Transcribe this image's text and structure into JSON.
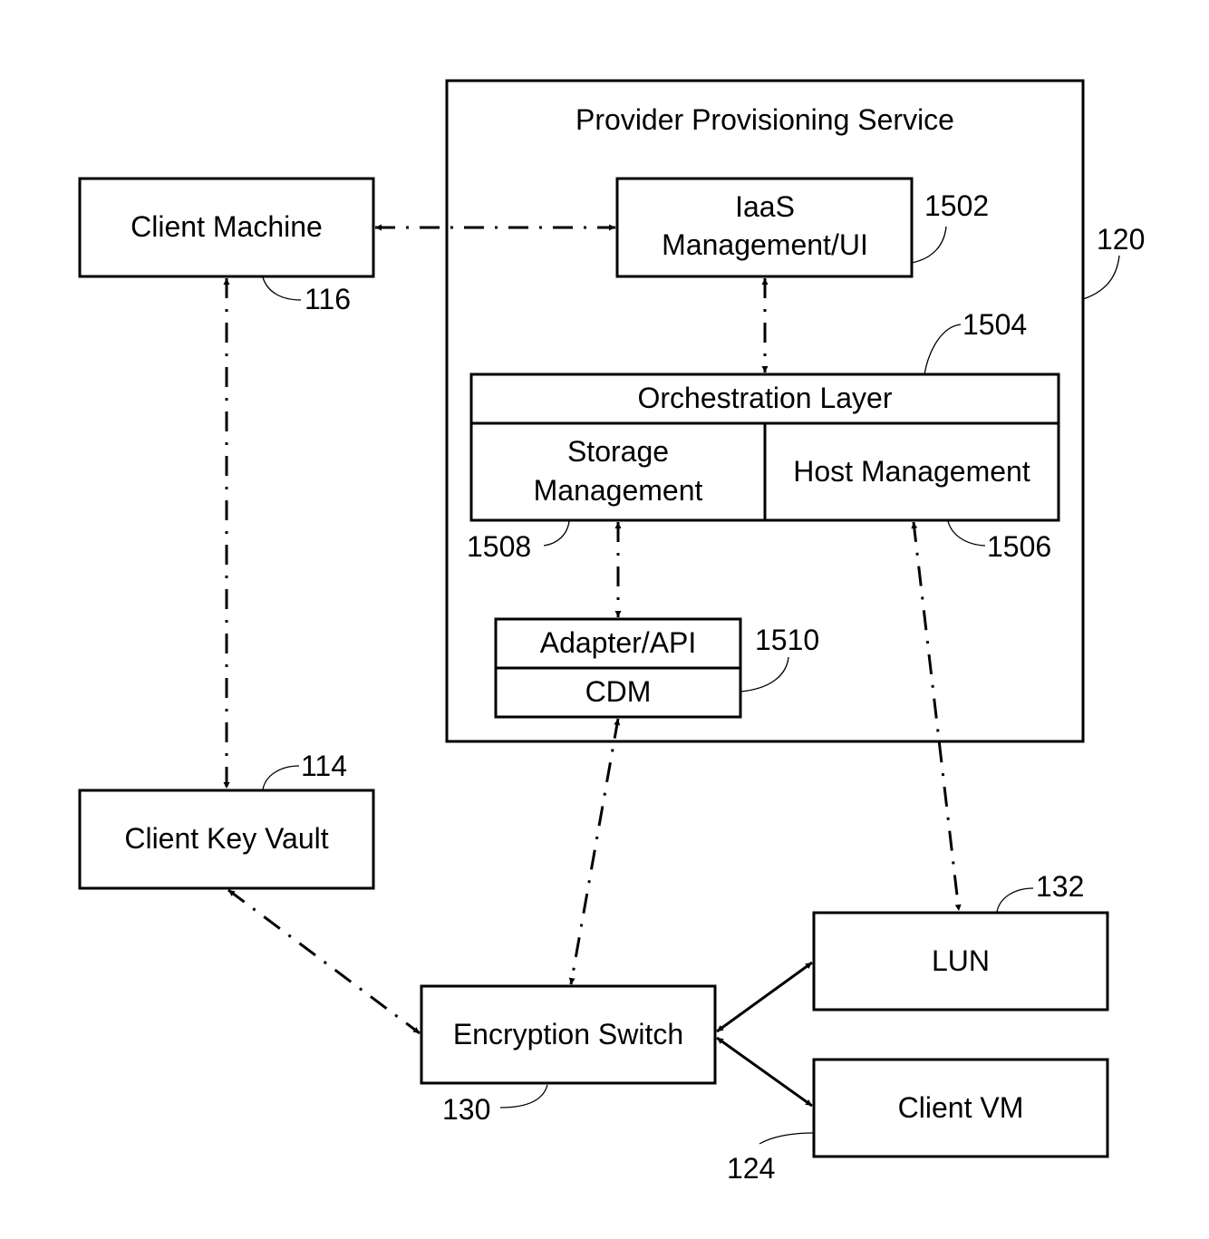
{
  "diagram": {
    "container": {
      "title": "Provider Provisioning Service",
      "ref": "120"
    },
    "nodes": {
      "client_machine": {
        "label": "Client Machine",
        "ref": "116"
      },
      "iaas": {
        "label_line1": "IaaS",
        "label_line2": "Management/UI",
        "ref": "1502"
      },
      "orchestration": {
        "label": "Orchestration Layer",
        "ref": "1504"
      },
      "storage_mgmt": {
        "label_line1": "Storage",
        "label_line2": "Management",
        "ref": "1508"
      },
      "host_mgmt": {
        "label": "Host Management",
        "ref": "1506"
      },
      "adapter": {
        "label_top": "Adapter/API",
        "label_bottom": "CDM",
        "ref": "1510"
      },
      "key_vault": {
        "label": "Client Key Vault",
        "ref": "114"
      },
      "encryption_switch": {
        "label": "Encryption Switch",
        "ref": "130"
      },
      "lun": {
        "label": "LUN",
        "ref": "132"
      },
      "client_vm": {
        "label": "Client VM",
        "ref": "124"
      }
    },
    "edges": [
      {
        "from": "client_machine",
        "to": "iaas",
        "style": "dash-dot",
        "direction": "bidirectional"
      },
      {
        "from": "iaas",
        "to": "orchestration",
        "style": "dash-dot",
        "direction": "bidirectional"
      },
      {
        "from": "storage_mgmt",
        "to": "adapter",
        "style": "dash-dot",
        "direction": "bidirectional"
      },
      {
        "from": "host_mgmt",
        "to": "lun",
        "style": "dash-dot",
        "direction": "bidirectional"
      },
      {
        "from": "client_machine",
        "to": "key_vault",
        "style": "dash-dot",
        "direction": "bidirectional"
      },
      {
        "from": "key_vault",
        "to": "encryption_switch",
        "style": "dash-dot",
        "direction": "bidirectional"
      },
      {
        "from": "adapter",
        "to": "encryption_switch",
        "style": "dash-dot",
        "direction": "bidirectional"
      },
      {
        "from": "encryption_switch",
        "to": "lun",
        "style": "solid",
        "direction": "bidirectional"
      },
      {
        "from": "encryption_switch",
        "to": "client_vm",
        "style": "solid",
        "direction": "bidirectional"
      }
    ]
  }
}
